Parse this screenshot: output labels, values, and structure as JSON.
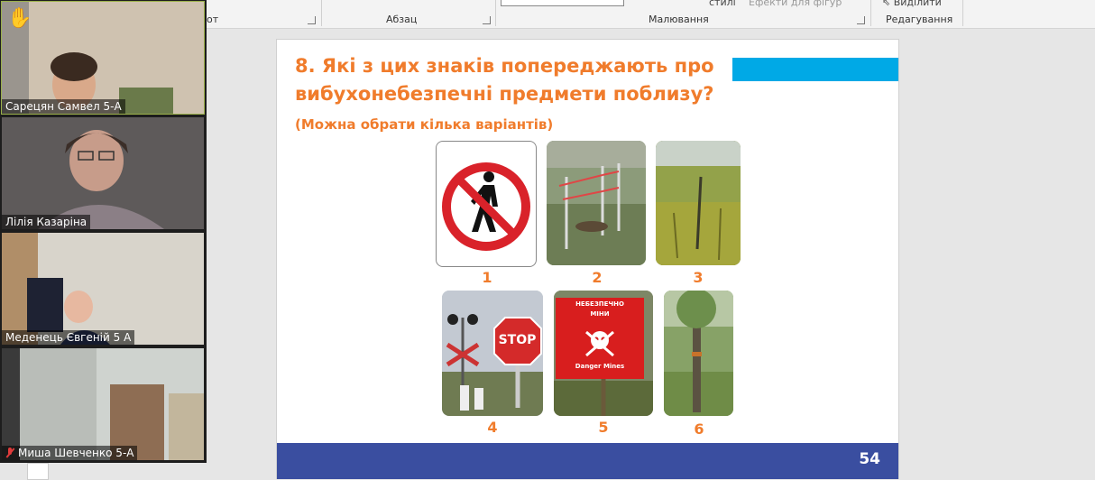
{
  "ribbon": {
    "font_group_partial": "от",
    "paragraph_label": "Абзац",
    "drawing_label": "Малювання",
    "editing_label": "Редагування",
    "styles_partial": "стилі",
    "shape_effects": "Ефекти для фігур",
    "select_label": "Виділити"
  },
  "participants": [
    {
      "name": "Сарецян Самвел 5-А",
      "hand_raised": true,
      "hand_icon": "✋"
    },
    {
      "name": "Лілія Казаріна"
    },
    {
      "name": "Меденець Євгеній 5 А"
    },
    {
      "name": "Миша Шевченко 5-А",
      "muted": true
    }
  ],
  "slide": {
    "title": "8. Які з цих знаків попереджають про вибухонебезпечні предмети поблизу?",
    "subtitle": "(Можна обрати кілька варіантів)",
    "page_number": "54",
    "numbers": [
      "1",
      "2",
      "3",
      "4",
      "5",
      "6"
    ],
    "stop_sign_text": "STOP",
    "mine_sign_line1": "НЕБЕЗПЕЧНО",
    "mine_sign_line2": "МІНИ",
    "mine_sign_line3": "Danger Mines",
    "colors": {
      "accent_orange": "#f07c2c",
      "accent_blue": "#00a9e6",
      "footer_blue": "#3a4ea0"
    }
  }
}
